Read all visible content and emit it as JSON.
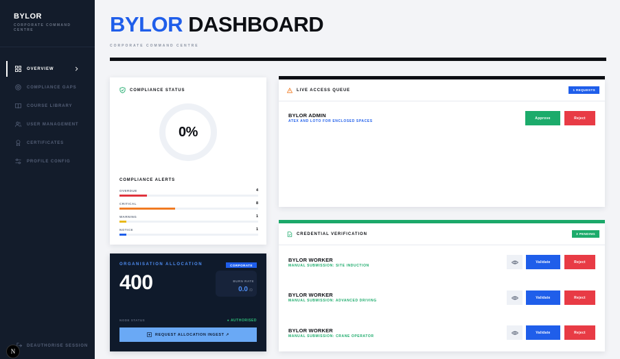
{
  "sidebar": {
    "brand": "BYLOR",
    "brand_sub": "CORPORATE COMMAND CENTRE",
    "items": [
      {
        "label": "OVERVIEW"
      },
      {
        "label": "COMPLIANCE GAPS"
      },
      {
        "label": "COURSE LIBRARY"
      },
      {
        "label": "USER MANAGEMENT"
      },
      {
        "label": "CERTIFICATES"
      },
      {
        "label": "PROFILE CONFIG"
      }
    ],
    "logout": "DEAUTHORISE SESSION",
    "next_badge": "N"
  },
  "header": {
    "title_accent": "BYLOR",
    "title_rest": "DASHBOARD",
    "subtitle": "CORPORATE COMMAND CENTRE"
  },
  "compliance": {
    "title": "COMPLIANCE STATUS",
    "value": "0%",
    "alerts_title": "COMPLIANCE ALERTS",
    "alerts": [
      {
        "label": "OVERDUE",
        "count": "4",
        "fill": 0.2,
        "color": "#e0323c"
      },
      {
        "label": "CRITICAL",
        "count": "8",
        "fill": 0.4,
        "color": "#f07a22"
      },
      {
        "label": "WARNING",
        "count": "1",
        "fill": 0.05,
        "color": "#e8b81a"
      },
      {
        "label": "NOTICE",
        "count": "1",
        "fill": 0.05,
        "color": "#1f5eea"
      }
    ]
  },
  "allocation": {
    "title": "ORGANISATION ALLOCATION",
    "badge": "CORPORATE",
    "value": "400",
    "burn_label": "BURN RATE",
    "burn_value": "0.0",
    "burn_unit": "/D",
    "node_status": "NODE STATUS",
    "authorised": "● AUTHORISED",
    "ingest_button": "REQUEST ALLOCATION INGEST ↗"
  },
  "queue": {
    "title": "LIVE ACCESS QUEUE",
    "badge": "1 REQUESTS",
    "requests": [
      {
        "name": "BYLOR ADMIN",
        "detail": "ATEX AND LOTO FOR ENCLOSED SPACES",
        "approve": "Approve",
        "reject": "Reject"
      }
    ]
  },
  "credentials": {
    "title": "CREDENTIAL VERIFICATION",
    "badge": "3 PENDING",
    "items": [
      {
        "name": "BYLOR WORKER",
        "detail": "MANUAL SUBMISSION: SITE INDUCTION",
        "validate": "Validate",
        "reject": "Reject"
      },
      {
        "name": "BYLOR WORKER",
        "detail": "MANUAL SUBMISSION: ADVANCED DRIVING",
        "validate": "Validate",
        "reject": "Reject"
      },
      {
        "name": "BYLOR WORKER",
        "detail": "MANUAL SUBMISSION: CRANE OPERATOR",
        "validate": "Validate",
        "reject": "Reject"
      }
    ]
  },
  "colors": {
    "accent": "#1f5eea",
    "success": "#1cab6b",
    "danger": "#e83b45",
    "sidebar": "#131c2b"
  }
}
